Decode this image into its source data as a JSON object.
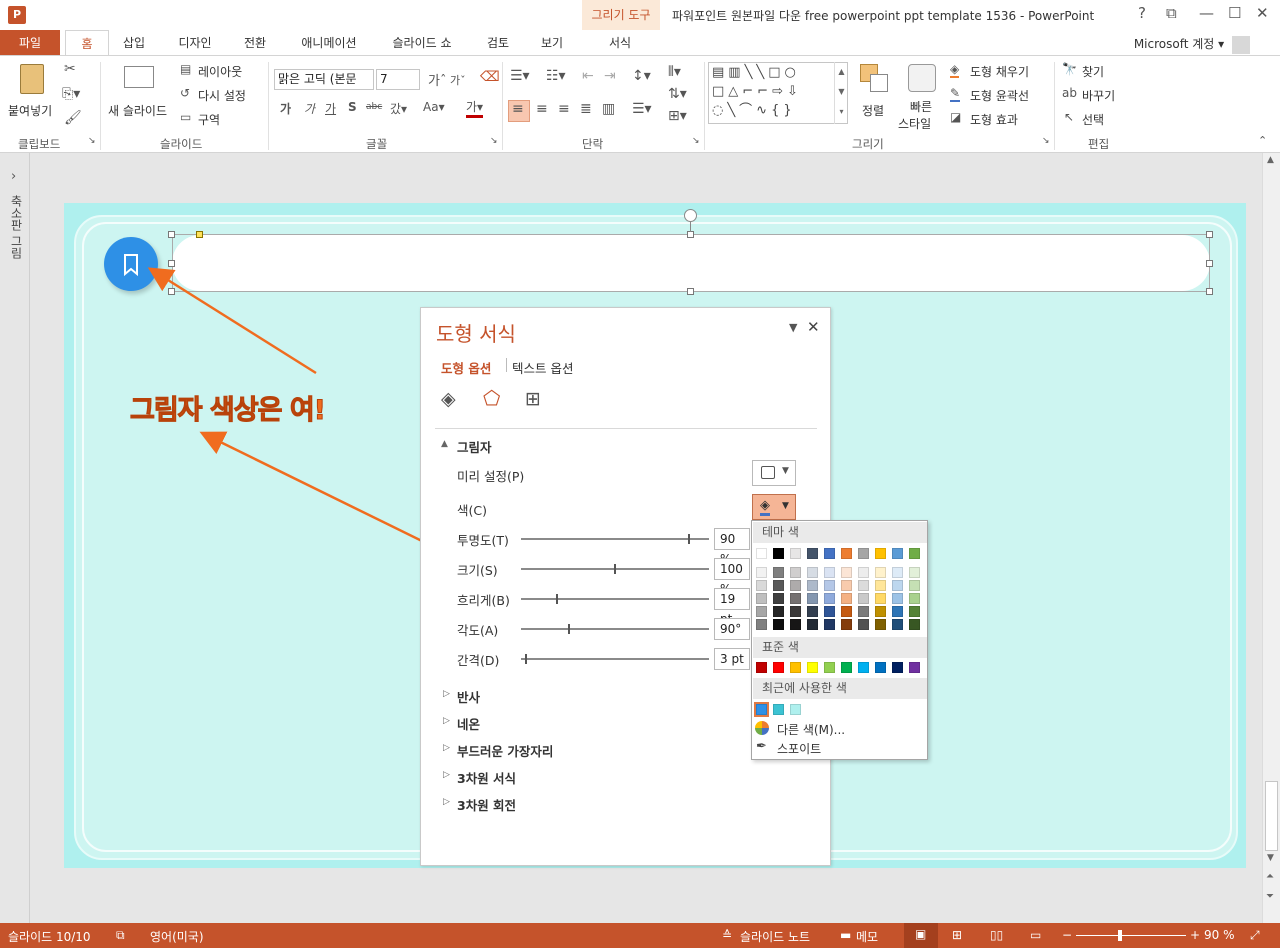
{
  "window": {
    "title": "파워포인트 원본파일 다운 free powerpoint ppt template 1536 - PowerPoint",
    "context_group": "그리기 도구",
    "account": "Microsoft 계정"
  },
  "tabs": {
    "file": "파일",
    "items": [
      "홈",
      "삽입",
      "디자인",
      "전환",
      "애니메이션",
      "슬라이드 쇼",
      "검토",
      "보기",
      "서식"
    ],
    "active": "홈"
  },
  "ribbon": {
    "clipboard": {
      "paste": "붙여넣기",
      "label": "클립보드"
    },
    "slides": {
      "new_slide": "새 슬라이드",
      "layout": "레이아웃",
      "reset": "다시 설정",
      "section": "구역",
      "label": "슬라이드"
    },
    "font": {
      "name": "맑은 고딕 (본문",
      "size": "7",
      "label": "글꼴"
    },
    "paragraph": {
      "label": "단락"
    },
    "drawing": {
      "arrange": "정렬",
      "quick_styles_1": "빠른",
      "quick_styles_2": "스타일",
      "fill": "도형 채우기",
      "outline": "도형 윤곽선",
      "effects": "도형 효과",
      "label": "그리기"
    },
    "editing": {
      "find": "찾기",
      "replace": "바꾸기",
      "select": "선택",
      "label": "편집"
    }
  },
  "left_panel": {
    "label": "축소판 그림"
  },
  "annotation": "그림자 색상은 여!",
  "format_pane": {
    "title": "도형 서식",
    "tab_shape": "도형 옵션",
    "tab_text": "텍스트 옵션",
    "section": "그림자",
    "preset_label": "미리 설정(P)",
    "color_label": "색(C)",
    "transparency": {
      "label": "투명도(T)",
      "value": "90 %",
      "fraction": 0.9
    },
    "size": {
      "label": "크기(S)",
      "value": "100 %",
      "fraction": 0.5
    },
    "blur": {
      "label": "흐리게(B)",
      "value": "19 pt",
      "fraction": 0.19
    },
    "angle": {
      "label": "각도(A)",
      "value": "90°",
      "fraction": 0.25
    },
    "distance": {
      "label": "간격(D)",
      "value": "3 pt",
      "fraction": 0.02
    },
    "collapsed_sections": [
      "반사",
      "네온",
      "부드러운 가장자리",
      "3차원 서식",
      "3차원 회전"
    ]
  },
  "color_popup": {
    "theme_header": "테마 색",
    "standard_header": "표준 색",
    "recent_header": "최근에 사용한 색",
    "more_colors": "다른 색(M)...",
    "eyedropper": "스포이트",
    "theme_top": [
      "#ffffff",
      "#000000",
      "#e7e6e6",
      "#44546a",
      "#4472c4",
      "#ed7d31",
      "#a5a5a5",
      "#ffc000",
      "#5b9bd5",
      "#70ad47"
    ],
    "theme_shades": [
      [
        "#f2f2f2",
        "#7f7f7f",
        "#d0cece",
        "#d6dce4",
        "#dae3f3",
        "#fbe5d6",
        "#ededed",
        "#fff2cc",
        "#deebf7",
        "#e2f0d9"
      ],
      [
        "#d9d9d9",
        "#595959",
        "#aeabab",
        "#adb9ca",
        "#b4c7e7",
        "#f8cbad",
        "#dbdbdb",
        "#ffe699",
        "#bdd7ee",
        "#c5e0b4"
      ],
      [
        "#bfbfbf",
        "#404040",
        "#757171",
        "#8497b0",
        "#8faadc",
        "#f4b183",
        "#c9c9c9",
        "#ffd966",
        "#9dc3e6",
        "#a9d18e"
      ],
      [
        "#a6a6a6",
        "#262626",
        "#3a3838",
        "#333f50",
        "#2f5597",
        "#c55a11",
        "#7b7b7b",
        "#bf9000",
        "#2e75b6",
        "#548235"
      ],
      [
        "#808080",
        "#0d0d0d",
        "#171616",
        "#222a35",
        "#203864",
        "#843c0c",
        "#525252",
        "#7f6000",
        "#1f4e79",
        "#385723"
      ]
    ],
    "standard": [
      "#c00000",
      "#ff0000",
      "#ffc000",
      "#ffff00",
      "#92d050",
      "#00b050",
      "#00b0f0",
      "#0070c0",
      "#002060",
      "#7030a0"
    ],
    "recent": [
      "#2e90e6",
      "#3cc3d3",
      "#aff0ee"
    ]
  },
  "status": {
    "slide": "슬라이드 10/10",
    "language": "영어(미국)",
    "notes": "슬라이드 노트",
    "comments": "메모",
    "zoom": "90 %"
  }
}
